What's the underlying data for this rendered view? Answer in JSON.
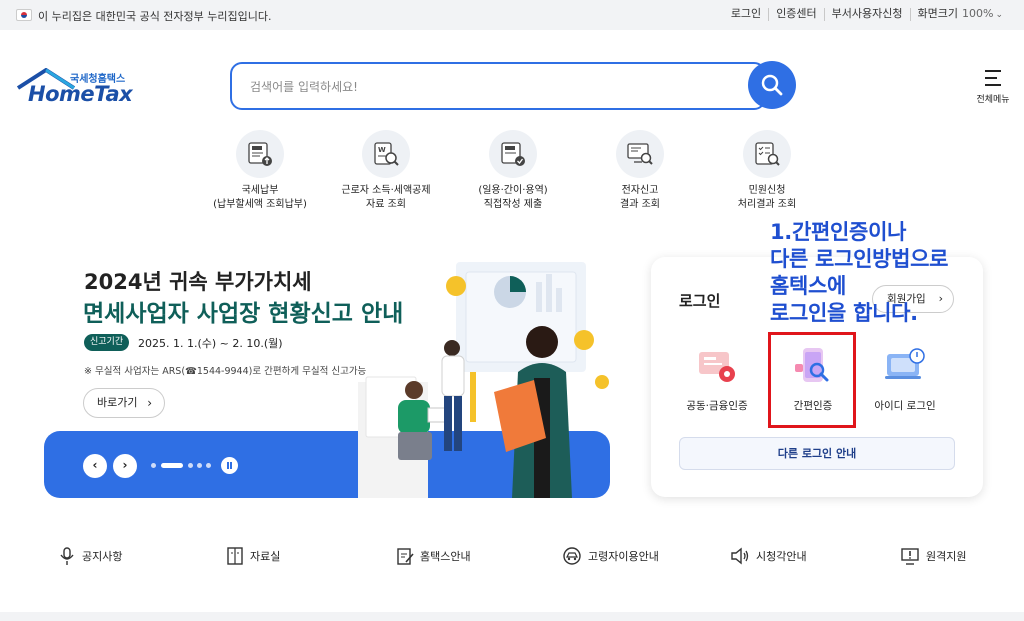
{
  "govbar": {
    "notice": "이 누리집은 대한민국 공식 전자정부 누리집입니다.",
    "links": [
      "로그인",
      "인증센터",
      "부서사용자신청",
      "화면크기"
    ],
    "zoom": "100%"
  },
  "logo": {
    "sub": "국세청홈택스",
    "main": "HomeTax"
  },
  "search": {
    "placeholder": "검색어를 입력하세요!"
  },
  "allmenu": {
    "label": "전체메뉴"
  },
  "quick": [
    {
      "line1": "국세납부",
      "line2": "(납부할세액 조회납부)",
      "icon": "tax-payment-icon"
    },
    {
      "line1": "근로자 소득·세액공제",
      "line2": "자료 조회",
      "icon": "document-search-icon"
    },
    {
      "line1": "(일용·간이·용역)",
      "line2": "직접작성 제출",
      "icon": "tax-check-icon"
    },
    {
      "line1": "전자신고",
      "line2": "결과 조회",
      "icon": "monitor-search-icon"
    },
    {
      "line1": "민원신청",
      "line2": "처리결과 조회",
      "icon": "checklist-search-icon"
    }
  ],
  "banner": {
    "title1": "2024년 귀속 부가가치세",
    "title2": "면세사업자 사업장 현황신고 안내",
    "period_label": "신고기간",
    "period": "2025. 1. 1.(수) ~ 2. 10.(월)",
    "note": "※ 무실적 사업자는 ARS(☎1544-9944)로 간편하게 무실적 신고가능",
    "go": "바로가기",
    "prev": "‹",
    "next": "›"
  },
  "login": {
    "title": "로그인",
    "join": "회원가입",
    "options": [
      "공동·금융인증",
      "간편인증",
      "아이디 로그인"
    ],
    "other": "다른 로그인 안내"
  },
  "annotation": "1.간편인증이나\n다른 로그인방법으로\n홈텍스에\n로그인을 합니다.",
  "bottom": [
    "공지사항",
    "자료실",
    "홈택스안내",
    "고령자이용안내",
    "시청각안내",
    "원격지원"
  ],
  "colors": {
    "brand": "#2f6fe4",
    "banner_green": "#0f5f59",
    "highlight": "#e0151b",
    "annotation": "#1f4fd0"
  }
}
